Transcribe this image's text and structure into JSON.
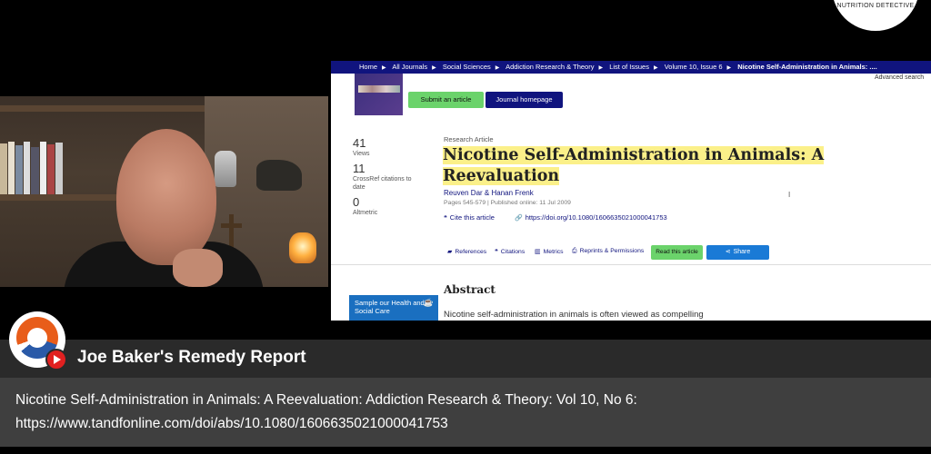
{
  "brand": {
    "text": "NUTRITION DETECTIVE"
  },
  "breadcrumb": {
    "items": [
      "Home",
      "All Journals",
      "Social Sciences",
      "Addiction Research & Theory",
      "List of Issues",
      "Volume 10, Issue 6"
    ],
    "current": "Nicotine Self-Administration in Animals: ...."
  },
  "header": {
    "advanced_search": "Advanced search",
    "submit_label": "Submit an article",
    "journal_home_label": "Journal homepage"
  },
  "metrics": [
    {
      "value": "41",
      "label": "Views"
    },
    {
      "value": "11",
      "label": "CrossRef citations to date"
    },
    {
      "value": "0",
      "label": "Altmetric"
    }
  ],
  "article": {
    "type": "Research Article",
    "title": "Nicotine Self-Administration in Animals: A Reevaluation",
    "authors": "Reuven Dar & Hanan Frenk",
    "pages_published": "Pages 545-579 | Published online: 11 Jul 2009",
    "cite_label": "Cite this article",
    "doi_label": "https://doi.org/10.1080/1606635021000041753"
  },
  "tools": {
    "references": "References",
    "citations": "Citations",
    "metrics": "Metrics",
    "reprints": "Reprints & Permissions",
    "read": "Read this article",
    "share": "Share"
  },
  "abstract": {
    "heading": "Abstract",
    "text": "Nicotine self-administration in animals is often viewed as compelling"
  },
  "promo": {
    "text": "Sample our Health and Social Care"
  },
  "overlay": {
    "channel_name": "Joe Baker's Remedy Report",
    "caption_line1": "Nicotine Self-Administration in Animals: A Reevaluation: Addiction Research & Theory: Vol 10, No 6:",
    "caption_line2": "https://www.tandfonline.com/doi/abs/10.1080/1606635021000041753"
  },
  "colors": {
    "nav_blue": "#10147e",
    "submit_green": "#6bd36b",
    "share_blue": "#1a7ad6",
    "highlight": "#fbf089",
    "youtube_red": "#e02020"
  }
}
